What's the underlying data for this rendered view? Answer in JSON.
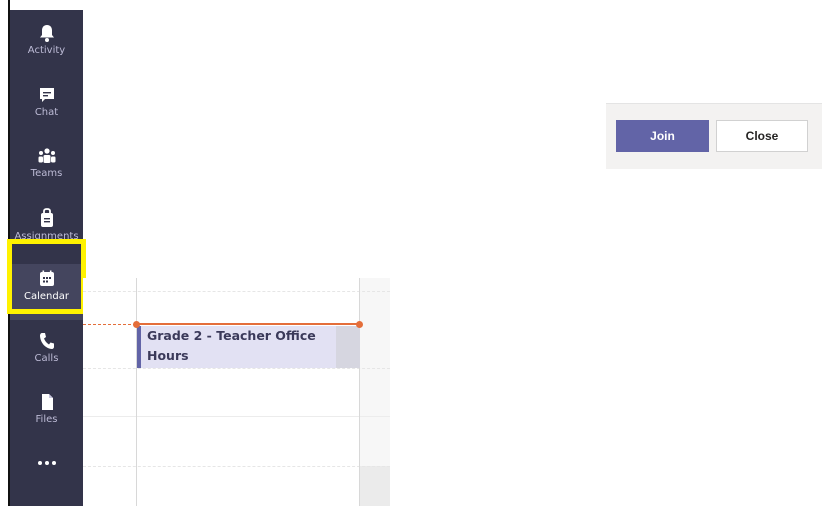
{
  "rail": {
    "items": [
      {
        "label": "Activity",
        "icon": "bell-icon"
      },
      {
        "label": "Chat",
        "icon": "chat-icon"
      },
      {
        "label": "Teams",
        "icon": "teams-icon"
      },
      {
        "label": "Assignments",
        "icon": "assignments-icon"
      },
      {
        "label": "Calendar",
        "icon": "calendar-icon"
      },
      {
        "label": "Calls",
        "icon": "phone-icon"
      },
      {
        "label": "Files",
        "icon": "file-icon"
      },
      {
        "label": "",
        "icon": "more-icon"
      }
    ],
    "active": "Calendar"
  },
  "popup": {
    "join_label": "Join",
    "close_label": "Close"
  },
  "event": {
    "title": "Grade 2 - Teacher Office Hours"
  },
  "colors": {
    "rail_bg": "#33344a",
    "accent": "#6264a7",
    "now_line": "#e46e3a",
    "highlight": "#fff200"
  }
}
